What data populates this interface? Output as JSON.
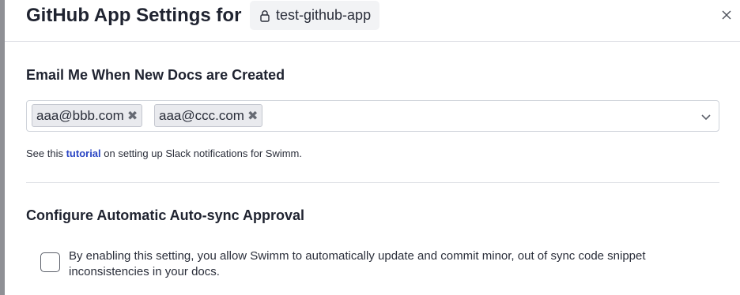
{
  "header": {
    "title": "GitHub App Settings for",
    "repo_name": "test-github-app",
    "repo_icon": "lock-icon",
    "close_icon": "close-icon"
  },
  "email_section": {
    "title": "Email Me When New Docs are Created",
    "tags": [
      {
        "label": "aaa@bbb.com",
        "remove": "✖"
      },
      {
        "label": "aaa@ccc.com",
        "remove": "✖"
      }
    ],
    "dropdown_icon": "chevron-down-icon",
    "help_prefix": "See this ",
    "help_link": "tutorial",
    "help_suffix": " on setting up Slack notifications for Swimm."
  },
  "autosync_section": {
    "title": "Configure Automatic Auto-sync Approval",
    "checkbox_checked": false,
    "checkbox_label": "By enabling this setting, you allow Swimm to automatically update and commit minor, out of sync code snippet inconsistencies in your docs."
  },
  "colors": {
    "link": "#2b46c4",
    "tag_bg": "#e9eaee",
    "pill_bg": "#f2f3f5"
  }
}
